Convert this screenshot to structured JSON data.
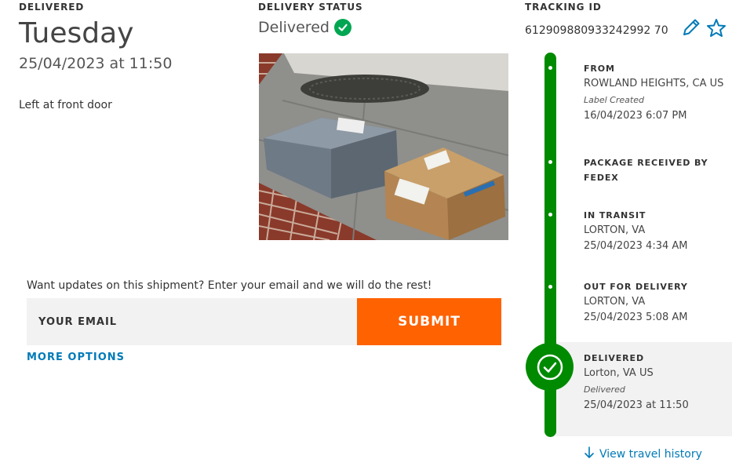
{
  "delivered": {
    "label": "DELIVERED",
    "day": "Tuesday",
    "datetime": "25/04/2023 at 11:50",
    "note": "Left at front door"
  },
  "status": {
    "label": "DELIVERY STATUS",
    "value": "Delivered"
  },
  "tracking": {
    "label": "TRACKING ID",
    "number": "612909880933242992 70"
  },
  "signup": {
    "prompt": "Want updates on this shipment? Enter your email and we will do the rest!",
    "placeholder": "YOUR EMAIL",
    "submit_label": "SUBMIT",
    "more_options": "MORE OPTIONS"
  },
  "timeline": {
    "from": {
      "title": "FROM",
      "location": "ROWLAND HEIGHTS, CA US",
      "sub_label": "Label Created",
      "time": "16/04/2023 6:07 PM"
    },
    "received": {
      "title_line1": "PACKAGE RECEIVED BY",
      "title_line2": "FEDEX"
    },
    "in_transit": {
      "title": "IN TRANSIT",
      "location": "LORTON, VA",
      "time": "25/04/2023 4:34 AM"
    },
    "out_for_delivery": {
      "title": "OUT FOR DELIVERY",
      "location": "LORTON, VA",
      "time": "25/04/2023 5:08 AM"
    },
    "delivered": {
      "title": "DELIVERED",
      "location": "Lorton, VA US",
      "sub_label": "Delivered",
      "time": "25/04/2023 at 11:50"
    },
    "view_history": "View travel history"
  },
  "colors": {
    "accent_orange": "#ff6200",
    "timeline_green": "#008a00",
    "link_blue": "#007ab7",
    "status_green": "#00a651"
  },
  "icons": {
    "status": "check-circle-icon",
    "edit": "pencil-icon",
    "favorite": "star-outline-icon",
    "marker": "checkmark-icon",
    "history": "arrow-down-icon"
  }
}
